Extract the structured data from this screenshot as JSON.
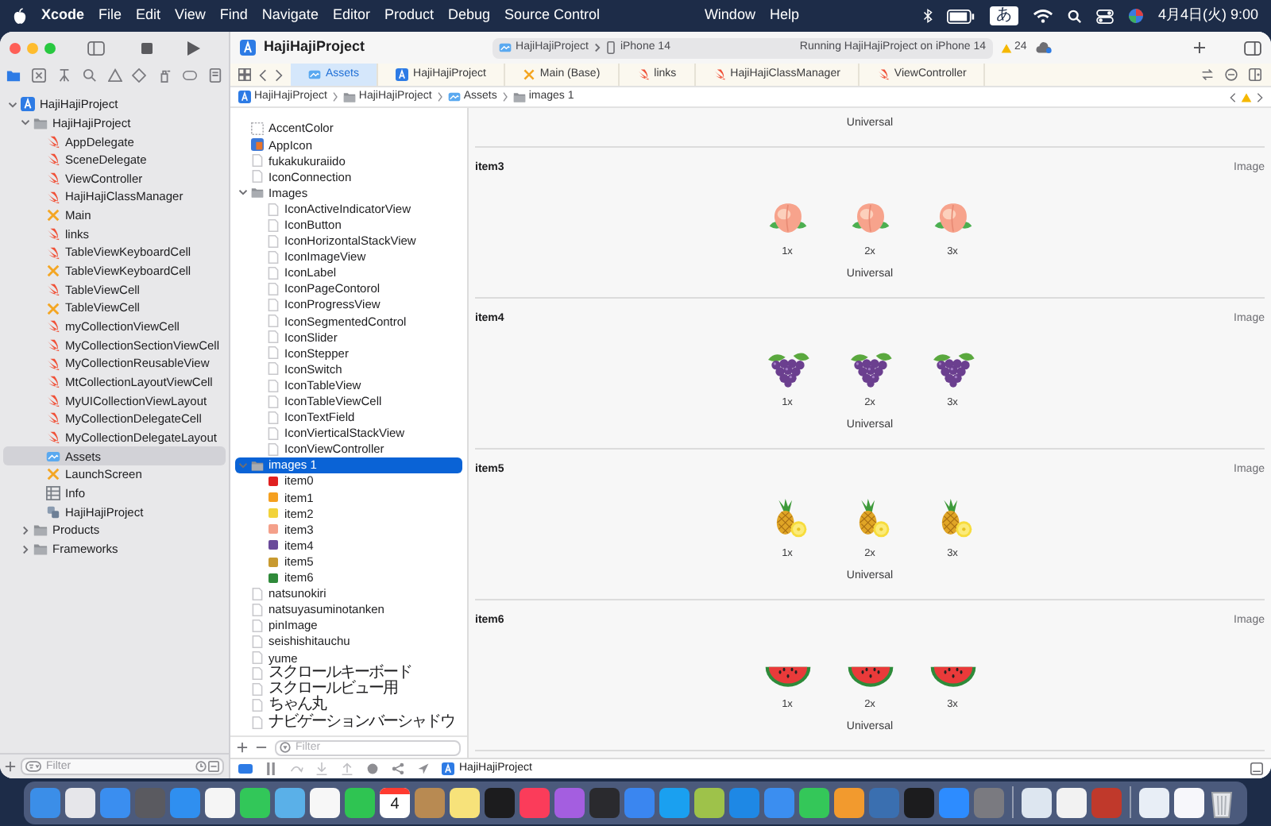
{
  "menu_bar": {
    "app": "Xcode",
    "menus": [
      "File",
      "Edit",
      "View",
      "Find",
      "Navigate",
      "Editor",
      "Product",
      "Debug",
      "Source Control"
    ],
    "right_menus": [
      "Window",
      "Help"
    ],
    "input_mode": "あ",
    "clock": "4月4日(火) 9:00"
  },
  "toolbar": {
    "title": "HajiHajiProject",
    "scheme": "HajiHajiProject",
    "device": "iPhone 14",
    "status": "Running HajiHajiProject on iPhone 14",
    "warnings": "24"
  },
  "tabs": [
    {
      "label": "Assets",
      "kind": "assets",
      "selected": true
    },
    {
      "label": "HajiHajiProject",
      "kind": "project",
      "selected": false
    },
    {
      "label": "Main (Base)",
      "kind": "storyboard",
      "selected": false
    },
    {
      "label": "links",
      "kind": "swift",
      "selected": false
    },
    {
      "label": "HajiHajiClassManager",
      "kind": "swift",
      "selected": false
    },
    {
      "label": "ViewController",
      "kind": "swift",
      "selected": false
    }
  ],
  "breadcrumb": [
    {
      "label": "HajiHajiProject",
      "kind": "project"
    },
    {
      "label": "HajiHajiProject",
      "kind": "folder"
    },
    {
      "label": "Assets",
      "kind": "assets"
    },
    {
      "label": "images 1",
      "kind": "folder"
    }
  ],
  "navigator": {
    "items": [
      {
        "label": "HajiHajiProject",
        "kind": "project",
        "expanded": true,
        "selected": false,
        "children": [
          {
            "label": "HajiHajiProject",
            "kind": "folder",
            "expanded": true,
            "selected": false,
            "children": [
              {
                "label": "AppDelegate",
                "kind": "swift",
                "selected": false
              },
              {
                "label": "SceneDelegate",
                "kind": "swift",
                "selected": false
              },
              {
                "label": "ViewController",
                "kind": "swift",
                "selected": false
              },
              {
                "label": "HajiHajiClassManager",
                "kind": "swift",
                "selected": false
              },
              {
                "label": "Main",
                "kind": "storyboard",
                "selected": false
              },
              {
                "label": "links",
                "kind": "swift",
                "selected": false
              },
              {
                "label": "TableViewKeyboardCell",
                "kind": "swift",
                "selected": false
              },
              {
                "label": "TableViewKeyboardCell",
                "kind": "storyboard",
                "selected": false
              },
              {
                "label": "TableViewCell",
                "kind": "swift",
                "selected": false
              },
              {
                "label": "TableViewCell",
                "kind": "storyboard",
                "selected": false
              },
              {
                "label": "myCollectionViewCell",
                "kind": "swift",
                "selected": false
              },
              {
                "label": "MyCollectionSectionViewCell",
                "kind": "swift",
                "selected": false
              },
              {
                "label": "MyCollectionReusableView",
                "kind": "swift",
                "selected": false
              },
              {
                "label": "MtCollectionLayoutViewCell",
                "kind": "swift",
                "selected": false
              },
              {
                "label": "MyUICollectionViewLayout",
                "kind": "swift",
                "selected": false
              },
              {
                "label": "MyCollectionDelegateCell",
                "kind": "swift",
                "selected": false
              },
              {
                "label": "MyCollectionDelegateLayout",
                "kind": "swift",
                "selected": false
              },
              {
                "label": "Assets",
                "kind": "assets",
                "selected": true
              },
              {
                "label": "LaunchScreen",
                "kind": "storyboard",
                "selected": false
              },
              {
                "label": "Info",
                "kind": "plist",
                "selected": false
              },
              {
                "label": "HajiHajiProject",
                "kind": "package",
                "selected": false
              }
            ]
          },
          {
            "label": "Products",
            "kind": "folder",
            "expanded": false,
            "selected": false
          },
          {
            "label": "Frameworks",
            "kind": "folder",
            "expanded": false,
            "selected": false
          }
        ]
      }
    ],
    "filter_placeholder": "Filter"
  },
  "asset_list": {
    "items": [
      {
        "label": "AccentColor",
        "kind": "color",
        "selected": false
      },
      {
        "label": "AppIcon",
        "kind": "appicon",
        "selected": false
      },
      {
        "label": "fukakukuraiido",
        "kind": "image",
        "selected": false
      },
      {
        "label": "IconConnection",
        "kind": "image",
        "selected": false
      },
      {
        "label": "Images",
        "kind": "folder",
        "expanded": true,
        "selected": false,
        "children": [
          {
            "label": "IconActiveIndicatorView",
            "kind": "image",
            "selected": false
          },
          {
            "label": "IconButton",
            "kind": "image",
            "selected": false
          },
          {
            "label": "IconHorizontalStackView",
            "kind": "image",
            "selected": false
          },
          {
            "label": "IconImageView",
            "kind": "image",
            "selected": false
          },
          {
            "label": "IconLabel",
            "kind": "image",
            "selected": false
          },
          {
            "label": "IconPageContorol",
            "kind": "image",
            "selected": false
          },
          {
            "label": "IconProgressView",
            "kind": "image",
            "selected": false
          },
          {
            "label": "IconSegmentedControl",
            "kind": "image",
            "selected": false
          },
          {
            "label": "IconSlider",
            "kind": "image",
            "selected": false
          },
          {
            "label": "IconStepper",
            "kind": "image",
            "selected": false
          },
          {
            "label": "IconSwitch",
            "kind": "image",
            "selected": false
          },
          {
            "label": "IconTableView",
            "kind": "image",
            "selected": false
          },
          {
            "label": "IconTableViewCell",
            "kind": "image",
            "selected": false
          },
          {
            "label": "IconTextField",
            "kind": "image",
            "selected": false
          },
          {
            "label": "IconVierticalStackView",
            "kind": "image",
            "selected": false
          },
          {
            "label": "IconViewController",
            "kind": "image",
            "selected": false
          }
        ]
      },
      {
        "label": "images 1",
        "kind": "folder",
        "expanded": true,
        "selected": true,
        "children": [
          {
            "label": "item0",
            "kind": "thumb",
            "color": "#e02020",
            "selected": false
          },
          {
            "label": "item1",
            "kind": "thumb",
            "color": "#f5a020",
            "selected": false
          },
          {
            "label": "item2",
            "kind": "thumb",
            "color": "#f2d33a",
            "selected": false
          },
          {
            "label": "item3",
            "kind": "thumb",
            "color": "#f4a08a",
            "selected": false
          },
          {
            "label": "item4",
            "kind": "thumb",
            "color": "#6a4a9a",
            "selected": false
          },
          {
            "label": "item5",
            "kind": "thumb",
            "color": "#c89a30",
            "selected": false
          },
          {
            "label": "item6",
            "kind": "thumb",
            "color": "#2f8a3a",
            "selected": false
          }
        ]
      },
      {
        "label": "natsunokiri",
        "kind": "image",
        "selected": false
      },
      {
        "label": "natsuyasuminotanken",
        "kind": "image",
        "selected": false
      },
      {
        "label": "pinImage",
        "kind": "image",
        "selected": false
      },
      {
        "label": "seishishitauchu",
        "kind": "image",
        "selected": false
      },
      {
        "label": "yume",
        "kind": "image",
        "selected": false
      },
      {
        "label": "スクロールキーボード",
        "kind": "image",
        "selected": false
      },
      {
        "label": "スクロールビュー用",
        "kind": "image",
        "selected": false
      },
      {
        "label": "ちゃん丸",
        "kind": "image",
        "selected": false
      },
      {
        "label": "ナビゲーションバーシャドウ",
        "kind": "image",
        "selected": false
      }
    ],
    "filter_placeholder": "Filter"
  },
  "canvas": {
    "partial_idiom": "Universal",
    "sets": [
      {
        "name": "item3",
        "type": "Image",
        "kind": "peach",
        "scales": [
          "1x",
          "2x",
          "3x"
        ],
        "idiom": "Universal"
      },
      {
        "name": "item4",
        "type": "Image",
        "kind": "grapes",
        "scales": [
          "1x",
          "2x",
          "3x"
        ],
        "idiom": "Universal"
      },
      {
        "name": "item5",
        "type": "Image",
        "kind": "pineapple",
        "scales": [
          "1x",
          "2x",
          "3x"
        ],
        "idiom": "Universal"
      },
      {
        "name": "item6",
        "type": "Image",
        "kind": "watermelon",
        "scales": [
          "1x",
          "2x",
          "3x"
        ],
        "idiom": "Universal"
      }
    ]
  },
  "debug_bar": {
    "target": "HajiHajiProject"
  },
  "dock": {
    "calendar_day": "4"
  }
}
